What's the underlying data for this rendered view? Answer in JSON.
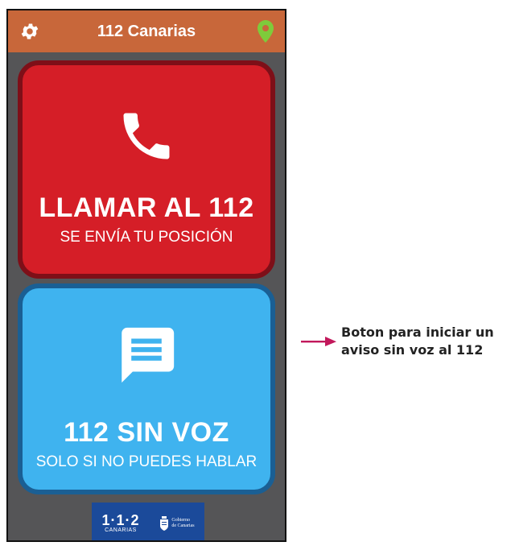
{
  "app": {
    "title": "112 Canarias",
    "settings_icon": "gear-icon",
    "location_icon": "location-pin-icon",
    "location_color": "#7ecb3b",
    "header_color": "#c8673a"
  },
  "call_button": {
    "icon": "phone-icon",
    "title": "LLAMAR AL 112",
    "subtitle": "SE ENVÍA TU POSICIÓN",
    "color": "#d51e27"
  },
  "no_voice_button": {
    "icon": "chat-message-icon",
    "title": "112 SIN VOZ",
    "subtitle": "SOLO SI NO PUEDES HABLAR",
    "color": "#3fb3ef"
  },
  "footer": {
    "logo_112_number": "1·1·2",
    "logo_112_sub": "CANARIAS",
    "gobierno_line1": "Gobierno",
    "gobierno_line2": "de Canarias"
  },
  "annotation": {
    "line1": "Boton para iniciar un",
    "line2": "aviso sin voz al 112",
    "arrow_color": "#c2185b"
  }
}
